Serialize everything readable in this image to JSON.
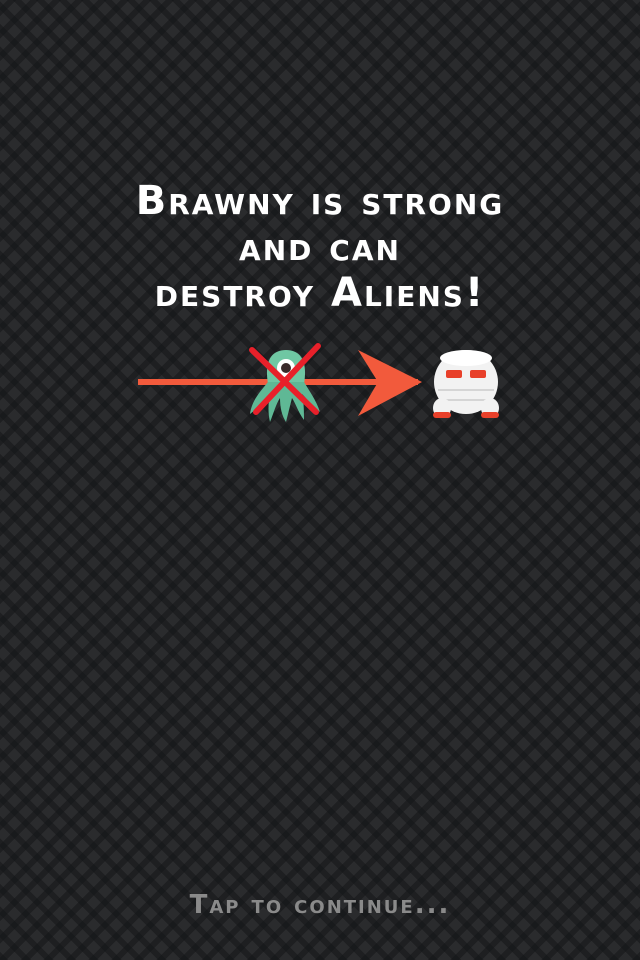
{
  "tutorial": {
    "message_lines": [
      "Brawny is strong",
      "and can",
      "destroy Aliens!"
    ]
  },
  "illustration": {
    "enemy_icon": "alien-icon",
    "player_icon": "brawny-robot-icon",
    "strike_icon": "x-mark-icon",
    "arrow_icon": "arrow-right-icon",
    "colors": {
      "arrow": "#f25a3c",
      "strike": "#e8202a",
      "alien": "#6fc7a3",
      "robot_body": "#f2f2f2",
      "robot_eyes": "#e8402a"
    }
  },
  "footer": {
    "continue_label": "Tap to continue..."
  }
}
